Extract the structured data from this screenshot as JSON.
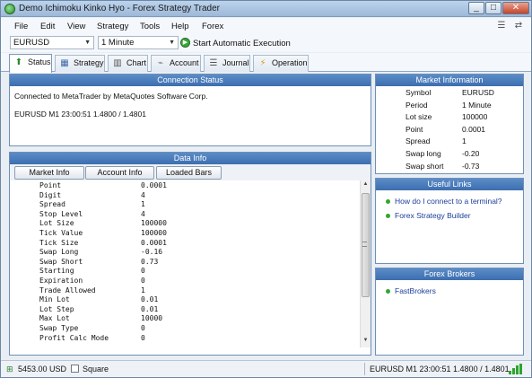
{
  "window": {
    "title": "Demo Ichimoku Kinko Hyo - Forex Strategy Trader",
    "min_glyph": "_",
    "max_glyph": "□",
    "close_glyph": "✕"
  },
  "menu": [
    "File",
    "Edit",
    "View",
    "Strategy",
    "Tools",
    "Help",
    "Forex"
  ],
  "toolbar": {
    "symbol": "EURUSD",
    "period": "1 Minute",
    "start_label": "Start Automatic Execution"
  },
  "tabs": [
    {
      "label": "Status",
      "icon": "status-icon"
    },
    {
      "label": "Strategy",
      "icon": "strategy-icon"
    },
    {
      "label": "Chart",
      "icon": "chart-icon"
    },
    {
      "label": "Account",
      "icon": "account-icon"
    },
    {
      "label": "Journal",
      "icon": "journal-icon"
    },
    {
      "label": "Operation",
      "icon": "operation-icon"
    }
  ],
  "connection": {
    "title": "Connection Status",
    "line1": "Connected to MetaTrader by MetaQuotes Software Corp.",
    "line2": "EURUSD M1 23:00:51 1.4800 / 1.4801"
  },
  "data_info": {
    "title": "Data Info",
    "subtabs": [
      "Market Info",
      "Account Info",
      "Loaded Bars"
    ],
    "rows": [
      {
        "k": "Point",
        "v": "0.0001"
      },
      {
        "k": "Digit",
        "v": "4"
      },
      {
        "k": "Spread",
        "v": "1"
      },
      {
        "k": "Stop Level",
        "v": "4"
      },
      {
        "k": "Lot Size",
        "v": "100000"
      },
      {
        "k": "Tick Value",
        "v": "100000"
      },
      {
        "k": "Tick Size",
        "v": "0.0001"
      },
      {
        "k": "Swap Long",
        "v": "-0.16"
      },
      {
        "k": "Swap Short",
        "v": " 0.73"
      },
      {
        "k": "Starting",
        "v": "0"
      },
      {
        "k": "Expiration",
        "v": "0"
      },
      {
        "k": "Trade Allowed",
        "v": "1"
      },
      {
        "k": "Min Lot",
        "v": "0.01"
      },
      {
        "k": "Lot Step",
        "v": "0.01"
      },
      {
        "k": "Max Lot",
        "v": "10000"
      },
      {
        "k": "Swap Type",
        "v": "0"
      },
      {
        "k": "Profit Calc Mode",
        "v": "0"
      }
    ]
  },
  "market_info": {
    "title": "Market Information",
    "rows": [
      {
        "k": "Symbol",
        "v": "EURUSD"
      },
      {
        "k": "Period",
        "v": "1 Minute"
      },
      {
        "k": "Lot size",
        "v": "100000"
      },
      {
        "k": "Point",
        "v": "0.0001"
      },
      {
        "k": "Spread",
        "v": "1"
      },
      {
        "k": "Swap long",
        "v": "-0.20"
      },
      {
        "k": "Swap short",
        "v": "-0.73"
      }
    ]
  },
  "useful_links": {
    "title": "Useful Links",
    "items": [
      "How do I connect to a terminal?",
      "Forex Strategy Builder"
    ]
  },
  "forex_brokers": {
    "title": "Forex Brokers",
    "items": [
      "FastBrokers"
    ]
  },
  "status_bar": {
    "balance": "5453.00 USD",
    "position": "Square",
    "tick": "EURUSD M1  23:00:51 1.4800 / 1.4801"
  },
  "colors": {
    "panel_header": "#4a7dbd",
    "link": "#1b3d99",
    "ok_green": "#32a632"
  }
}
